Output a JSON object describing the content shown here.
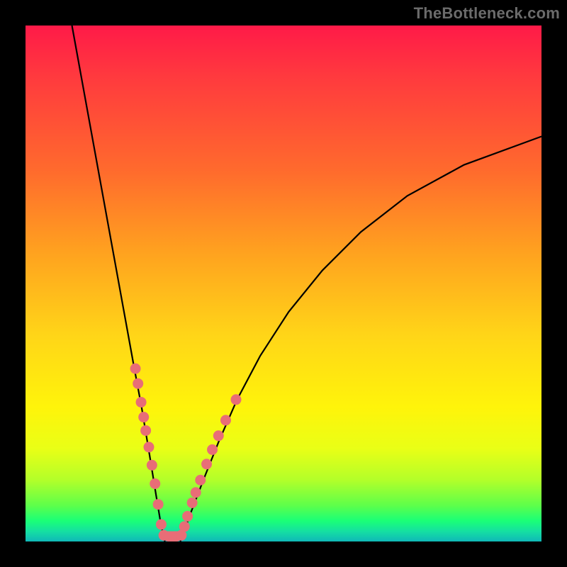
{
  "watermark": "TheBottleneck.com",
  "chart_data": {
    "type": "line",
    "title": "",
    "xlabel": "",
    "ylabel": "",
    "xlim": [
      0,
      1
    ],
    "ylim": [
      0,
      1
    ],
    "curve_left": {
      "x": [
        0.09,
        0.11,
        0.13,
        0.15,
        0.17,
        0.19,
        0.21,
        0.225,
        0.24,
        0.253,
        0.263,
        0.27
      ],
      "y": [
        1.0,
        0.89,
        0.78,
        0.67,
        0.56,
        0.45,
        0.34,
        0.26,
        0.17,
        0.09,
        0.03,
        0.0
      ]
    },
    "curve_right": {
      "x": [
        0.3,
        0.32,
        0.345,
        0.375,
        0.41,
        0.455,
        0.51,
        0.575,
        0.65,
        0.74,
        0.85,
        1.0
      ],
      "y": [
        0.0,
        0.055,
        0.12,
        0.195,
        0.275,
        0.36,
        0.445,
        0.525,
        0.6,
        0.67,
        0.73,
        0.785
      ]
    },
    "valley_bar": {
      "x0": 0.267,
      "x1": 0.303,
      "y": 0.01,
      "height": 0.02
    },
    "markers_left": [
      {
        "x": 0.213,
        "y": 0.335
      },
      {
        "x": 0.218,
        "y": 0.306
      },
      {
        "x": 0.224,
        "y": 0.27
      },
      {
        "x": 0.229,
        "y": 0.241
      },
      {
        "x": 0.233,
        "y": 0.215
      },
      {
        "x": 0.239,
        "y": 0.183
      },
      {
        "x": 0.245,
        "y": 0.148
      },
      {
        "x": 0.251,
        "y": 0.112
      },
      {
        "x": 0.257,
        "y": 0.072
      },
      {
        "x": 0.263,
        "y": 0.033
      }
    ],
    "markers_right": [
      {
        "x": 0.308,
        "y": 0.029
      },
      {
        "x": 0.314,
        "y": 0.049
      },
      {
        "x": 0.323,
        "y": 0.075
      },
      {
        "x": 0.33,
        "y": 0.095
      },
      {
        "x": 0.339,
        "y": 0.119
      },
      {
        "x": 0.351,
        "y": 0.15
      },
      {
        "x": 0.362,
        "y": 0.178
      },
      {
        "x": 0.374,
        "y": 0.205
      },
      {
        "x": 0.388,
        "y": 0.235
      },
      {
        "x": 0.408,
        "y": 0.275
      }
    ],
    "valley_end_markers": [
      {
        "x": 0.268,
        "y": 0.012
      },
      {
        "x": 0.302,
        "y": 0.012
      }
    ]
  },
  "colors": {
    "marker": "#e86d77",
    "curve": "#000000",
    "frame": "#000000",
    "watermark": "#6b6b6b"
  }
}
